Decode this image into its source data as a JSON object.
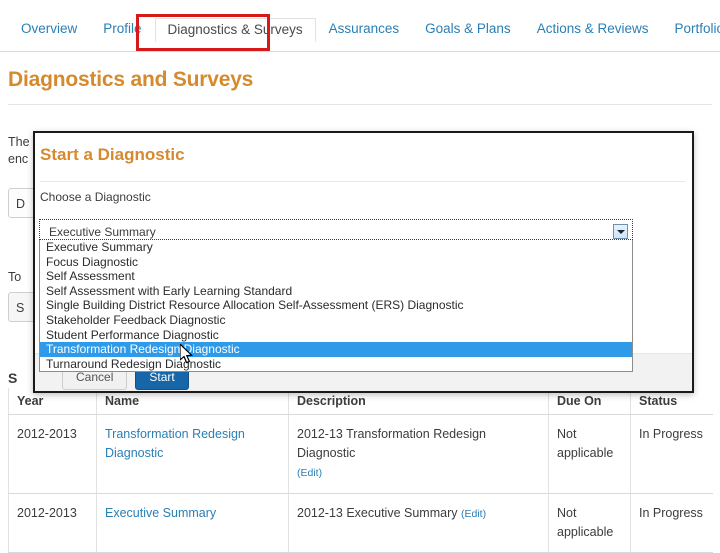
{
  "nav": {
    "tabs": [
      {
        "label": "Overview",
        "active": false
      },
      {
        "label": "Profile",
        "active": false
      },
      {
        "label": "Diagnostics & Surveys",
        "active": true
      },
      {
        "label": "Assurances",
        "active": false
      },
      {
        "label": "Goals & Plans",
        "active": false
      },
      {
        "label": "Actions & Reviews",
        "active": false
      },
      {
        "label": "Portfolio",
        "active": false
      }
    ],
    "highlight_color": "#d61a1a"
  },
  "page": {
    "title": "Diagnostics and Surveys",
    "title_color": "#d68a2e",
    "intro_line_1": "The",
    "intro_line_2": "enc",
    "bg_select_value": "D",
    "bg_label_1": "",
    "bg_label_2": "To",
    "bg_button_label": "S",
    "bg_section_heading": "S"
  },
  "modal": {
    "title": "Start a Diagnostic",
    "choose_label": "Choose a Diagnostic",
    "select": {
      "value": "Executive Summary",
      "expanded": true,
      "options": [
        "Executive Summary",
        "Focus Diagnostic",
        "Self Assessment",
        "Self Assessment with Early Learning Standard",
        "Single Building District Resource Allocation Self-Assessment (ERS) Diagnostic",
        "Stakeholder Feedback Diagnostic",
        "Student Performance Diagnostic",
        "Transformation Redesign Diagnostic",
        "Turnaround Redesign Diagnostic"
      ],
      "highlighted_option": "Transformation Redesign Diagnostic",
      "highlight_color": "#2f9ae8"
    },
    "cancel_label": "Cancel",
    "start_label": "Start",
    "start_color": "#1767a8"
  },
  "table": {
    "headers": [
      "Year",
      "Name",
      "Description",
      "Due On",
      "Status"
    ],
    "rows": [
      {
        "year": "2012-2013",
        "name": "Transformation Redesign Diagnostic",
        "description": "2012-13 Transformation Redesign Diagnostic",
        "edit_label": "(Edit)",
        "due_on": "Not applicable",
        "status": "In Progress"
      },
      {
        "year": "2012-2013",
        "name": "Executive Summary",
        "description": "2012-13 Executive Summary",
        "edit_label": "(Edit)",
        "due_on": "Not applicable",
        "status": "In Progress"
      }
    ]
  }
}
